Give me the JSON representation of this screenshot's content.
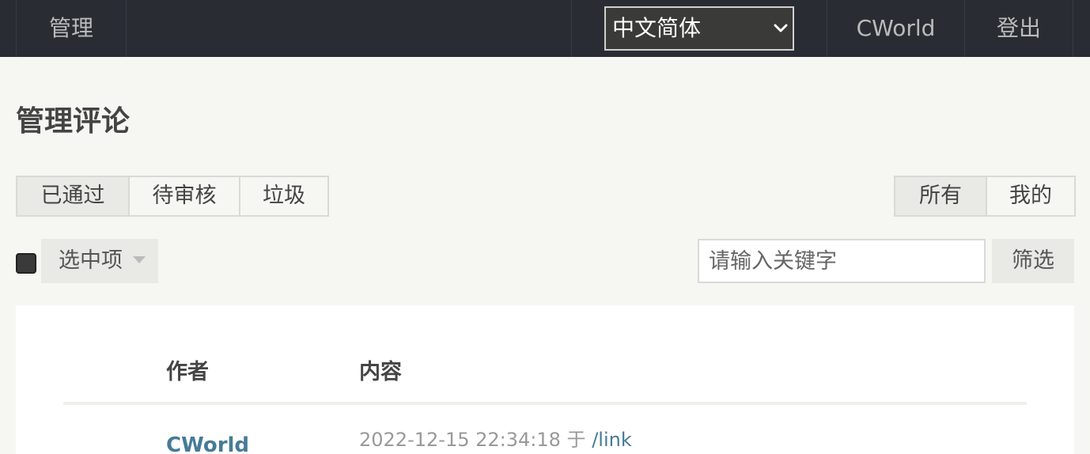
{
  "nav": {
    "admin": "管理",
    "language": "中文简体",
    "user": "CWorld",
    "logout": "登出"
  },
  "page": {
    "title": "管理评论"
  },
  "status_tabs": [
    {
      "label": "已通过",
      "active": true
    },
    {
      "label": "待审核",
      "active": false
    },
    {
      "label": "垃圾",
      "active": false
    }
  ],
  "scope_tabs": [
    {
      "label": "所有",
      "active": true
    },
    {
      "label": "我的",
      "active": false
    }
  ],
  "operations": {
    "bulk_label": "选中项",
    "search_placeholder": "请输入关键字",
    "filter_label": "筛选"
  },
  "table": {
    "columns": [
      "作者",
      "内容"
    ],
    "rows": [
      {
        "author": "CWorld",
        "date": "2022-12-15 22:34:18",
        "at": "于",
        "link": "/link"
      }
    ]
  },
  "colors": {
    "nav_bg": "#292d33",
    "page_bg": "#f6f6f3",
    "link": "#467b96"
  },
  "icons": {
    "language_select": "chevron-down-icon",
    "bulk_dropdown": "caret-down-icon"
  }
}
